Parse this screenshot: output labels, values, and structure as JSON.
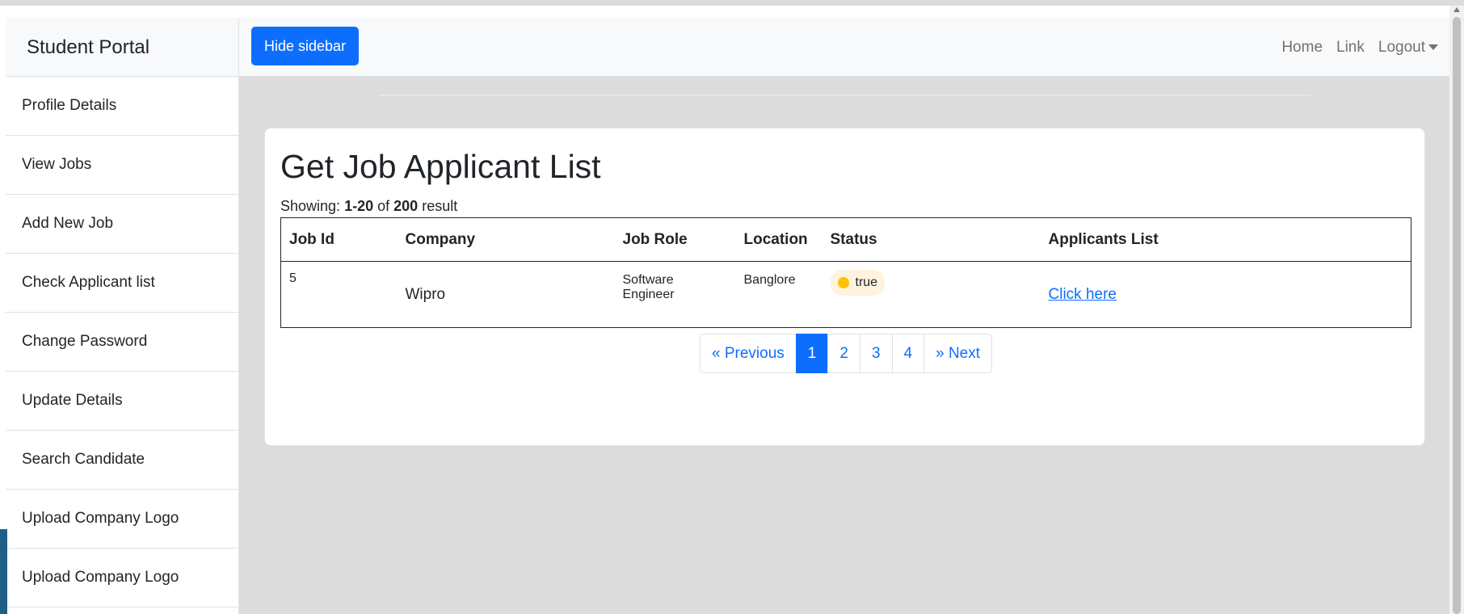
{
  "sidebar": {
    "heading": "Student Portal",
    "items": [
      {
        "label": "Profile Details"
      },
      {
        "label": "View Jobs"
      },
      {
        "label": "Add New Job"
      },
      {
        "label": "Check Applicant list"
      },
      {
        "label": "Change Password"
      },
      {
        "label": "Update Details"
      },
      {
        "label": "Search Candidate"
      },
      {
        "label": "Upload Company Logo"
      },
      {
        "label": "Upload Company Logo"
      }
    ]
  },
  "navbar": {
    "toggle_label": "Hide sidebar",
    "links": {
      "home": "Home",
      "link": "Link",
      "logout": "Logout"
    }
  },
  "card": {
    "title": "Get Job Applicant List",
    "showing": {
      "prefix": "Showing:",
      "range": "1-20",
      "of": "of",
      "total": "200",
      "suffix": "result"
    }
  },
  "table": {
    "headers": [
      "Job Id",
      "Company",
      "Job Role",
      "Location",
      "Status",
      "Applicants List"
    ],
    "rows": [
      {
        "job_id": "5",
        "company": "Wipro",
        "job_role": "Software Engineer",
        "location": "Banglore",
        "status": "true",
        "link": "Click here"
      }
    ]
  },
  "pagination": {
    "previous": "« Previous",
    "pages": [
      "1",
      "2",
      "3",
      "4"
    ],
    "active_page": "1",
    "next": "» Next"
  },
  "colors": {
    "primary": "#0d6efd",
    "status_dot": "#ffc107",
    "status_bg": "#fff3e0",
    "content_bg": "#dcdcdc"
  }
}
